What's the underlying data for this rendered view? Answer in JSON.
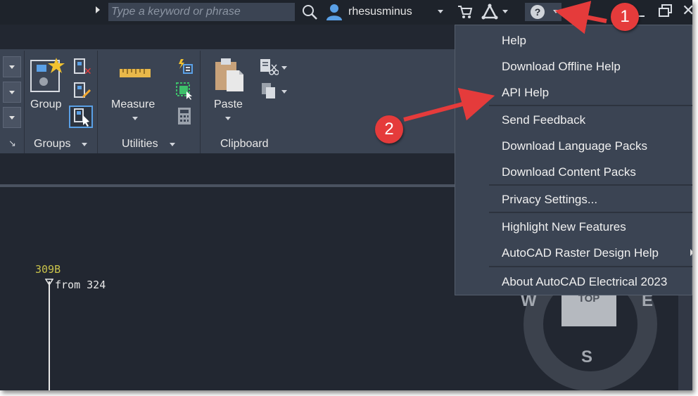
{
  "topbar": {
    "search_placeholder": "Type a keyword or phrase",
    "user_name": "rhesusminus",
    "help_glyph": "?"
  },
  "ribbon": {
    "panels": [
      {
        "label": "Groups",
        "button": "Group"
      },
      {
        "label": "Utilities",
        "button": "Measure"
      },
      {
        "label": "Clipboard",
        "button": "Paste"
      }
    ]
  },
  "canvas": {
    "wire_label": "309B",
    "from_label": "from  324",
    "viewcube_top": "TOP",
    "compass_w": "W",
    "compass_e": "E",
    "compass_s": "S"
  },
  "help_menu": {
    "items": [
      {
        "label": "Help"
      },
      {
        "label": "Download Offline Help"
      },
      {
        "label": "API Help"
      },
      {
        "label": "Send Feedback"
      },
      {
        "label": "Download Language Packs"
      },
      {
        "label": "Download Content Packs"
      },
      {
        "label": "Privacy Settings..."
      },
      {
        "label": "Highlight New Features"
      },
      {
        "label": "AutoCAD Raster Design Help"
      },
      {
        "label": "About AutoCAD Electrical 2023"
      }
    ]
  },
  "annotations": {
    "badge_1": "1",
    "badge_2": "2",
    "color": "#e53b3b"
  },
  "icons": [
    "search-icon",
    "user-icon",
    "cart-icon",
    "autodesk-a360-icon",
    "help-icon",
    "minimize-icon",
    "restore-icon",
    "close-icon",
    "group-icon",
    "ungroup-icon",
    "group-edit-icon",
    "group-select-icon",
    "ruler-icon",
    "quick-select-icon",
    "select-all-icon",
    "calculator-icon",
    "paste-icon",
    "cut-icon",
    "copy-icon"
  ]
}
